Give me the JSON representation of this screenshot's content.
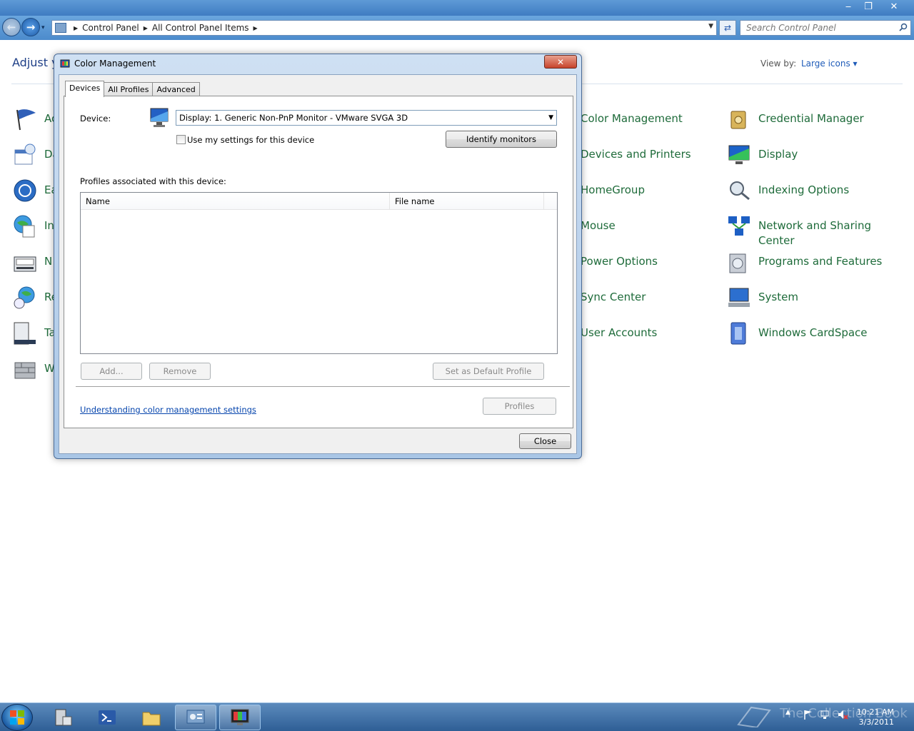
{
  "explorer": {
    "breadcrumb": [
      "Control Panel",
      "All Control Panel Items"
    ],
    "search_placeholder": "Search Control Panel",
    "header": "Adjust y",
    "view_by_label": "View by:",
    "view_by_value": "Large icons ▾"
  },
  "control_panel": {
    "left_column": [
      {
        "label": "Ac",
        "icon": "action-center-flag-icon"
      },
      {
        "label": "Da",
        "icon": "date-time-icon"
      },
      {
        "label": "Ea",
        "icon": "ease-of-access-icon"
      },
      {
        "label": "In",
        "icon": "internet-options-icon"
      },
      {
        "label": "N",
        "icon": "notification-area-icon"
      },
      {
        "label": "Re",
        "icon": "region-language-icon"
      },
      {
        "label": "Ta",
        "icon": "taskbar-start-menu-icon"
      },
      {
        "label": "W",
        "icon": "windows-firewall-icon"
      }
    ],
    "middle_column": [
      {
        "label": "Color Management"
      },
      {
        "label": "Devices and Printers"
      },
      {
        "label": "HomeGroup"
      },
      {
        "label": "Mouse"
      },
      {
        "label": "Power Options"
      },
      {
        "label": "Sync Center"
      },
      {
        "label": "User Accounts"
      }
    ],
    "right_column": [
      {
        "label": "Credential Manager",
        "icon": "credential-manager-icon"
      },
      {
        "label": "Display",
        "icon": "display-icon"
      },
      {
        "label": "Indexing Options",
        "icon": "indexing-options-icon"
      },
      {
        "label": "Network and Sharing Center",
        "icon": "network-sharing-icon"
      },
      {
        "label": "Programs and Features",
        "icon": "programs-features-icon"
      },
      {
        "label": "System",
        "icon": "system-icon"
      },
      {
        "label": "Windows CardSpace",
        "icon": "cardspace-icon"
      }
    ]
  },
  "dialog": {
    "title": "Color Management",
    "close_glyph": "✕",
    "tabs": [
      "Devices",
      "All Profiles",
      "Advanced"
    ],
    "device_label": "Device:",
    "device_value": "Display: 1. Generic Non-PnP Monitor - VMware SVGA 3D",
    "use_my_settings": "Use my settings for this device",
    "identify_monitors": "Identify monitors",
    "profiles_label": "Profiles associated with this device:",
    "columns": [
      "Name",
      "File name"
    ],
    "add_button": "Add...",
    "remove_button": "Remove",
    "set_default_button": "Set as Default Profile",
    "help_link": "Understanding color management settings",
    "profiles_button": "Profiles",
    "close_button": "Close"
  },
  "taskbar": {
    "time": "10:21 AM",
    "date": "3/3/2011",
    "watermark": "The Collection Book"
  }
}
